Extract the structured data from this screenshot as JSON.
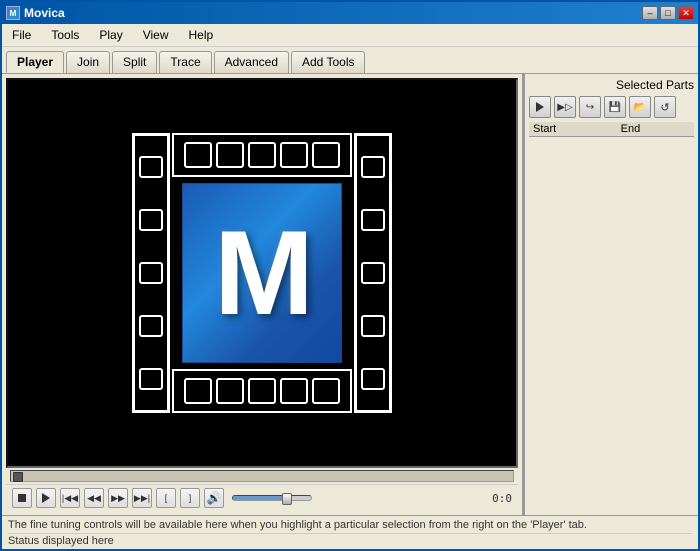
{
  "window": {
    "title": "Movica",
    "icon_label": "M"
  },
  "title_buttons": {
    "minimize": "–",
    "maximize": "□",
    "close": "✕"
  },
  "menu": {
    "items": [
      "File",
      "Tools",
      "Play",
      "View",
      "Help"
    ]
  },
  "tabs": {
    "items": [
      "Player",
      "Join",
      "Split",
      "Trace",
      "Advanced",
      "Add Tools"
    ],
    "active": "Player"
  },
  "right_panel": {
    "title": "Selected Parts",
    "table_headers": [
      "Start",
      "End"
    ]
  },
  "controls": {
    "time": "0:0"
  },
  "status": {
    "info_text": "The fine tuning controls will be available here when you highlight a particular selection from the right on the 'Player' tab.",
    "status_text": "Status displayed here"
  }
}
